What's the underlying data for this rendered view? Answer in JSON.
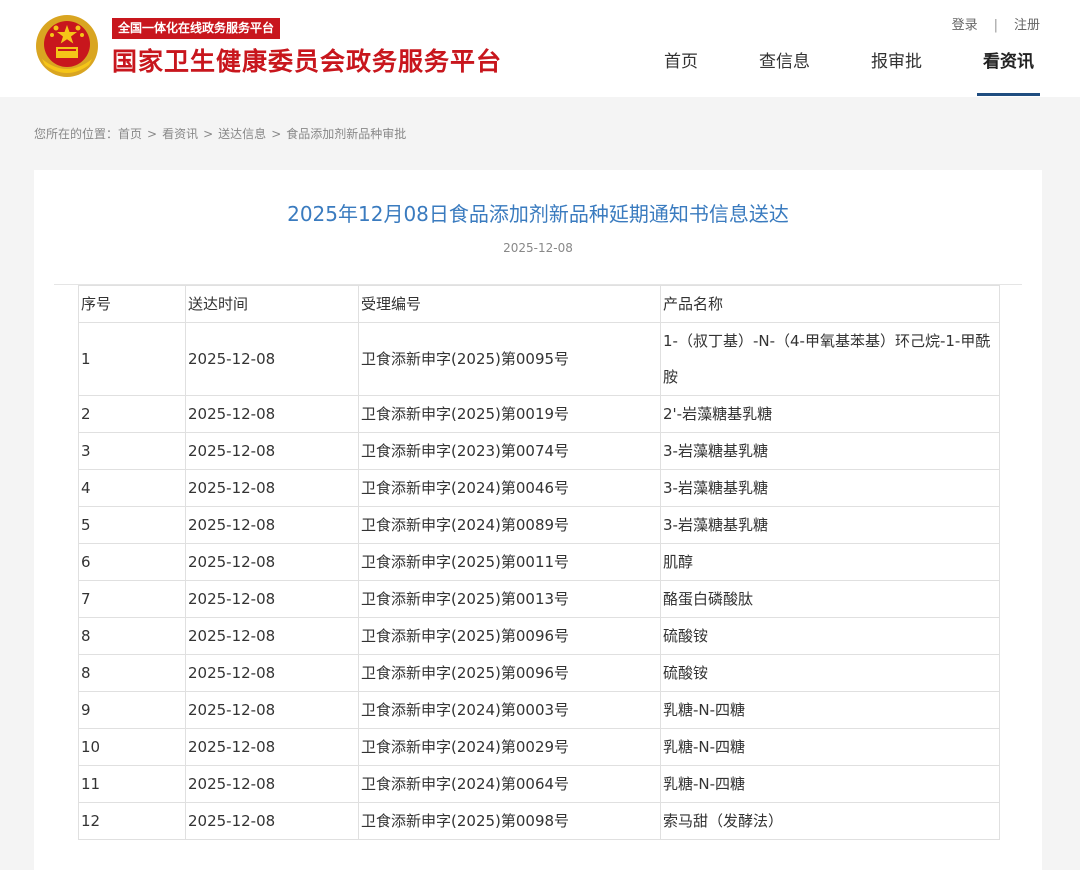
{
  "header": {
    "slogan": "全国一体化在线政务服务平台",
    "site_title": "国家卫生健康委员会政务服务平台",
    "login": "登录",
    "separator": "|",
    "register": "注册",
    "nav": [
      {
        "label": "首页"
      },
      {
        "label": "查信息"
      },
      {
        "label": "报审批"
      },
      {
        "label": "看资讯",
        "active": true
      }
    ]
  },
  "breadcrumb": {
    "prefix": "您所在的位置：",
    "items": [
      "首页",
      "看资讯",
      "送达信息",
      "食品添加剂新品种审批"
    ],
    "separator": ">"
  },
  "article": {
    "title": "2025年12月08日食品添加剂新品种延期通知书信息送达",
    "date": "2025-12-08"
  },
  "table": {
    "headers": [
      "序号",
      "送达时间",
      "受理编号",
      "产品名称"
    ],
    "rows": [
      [
        "1",
        "2025-12-08",
        "卫食添新申字(2025)第0095号",
        "1-（叔丁基）-N-（4-甲氧基苯基）环己烷-1-甲酰胺"
      ],
      [
        "2",
        "2025-12-08",
        "卫食添新申字(2025)第0019号",
        "2'-岩藻糖基乳糖"
      ],
      [
        "3",
        "2025-12-08",
        "卫食添新申字(2023)第0074号",
        "3-岩藻糖基乳糖"
      ],
      [
        "4",
        "2025-12-08",
        "卫食添新申字(2024)第0046号",
        "3-岩藻糖基乳糖"
      ],
      [
        "5",
        "2025-12-08",
        "卫食添新申字(2024)第0089号",
        "3-岩藻糖基乳糖"
      ],
      [
        "6",
        "2025-12-08",
        "卫食添新申字(2025)第0011号",
        "肌醇"
      ],
      [
        "7",
        "2025-12-08",
        "卫食添新申字(2025)第0013号",
        "酪蛋白磷酸肽"
      ],
      [
        "8",
        "2025-12-08",
        "卫食添新申字(2025)第0096号",
        "硫酸铵"
      ],
      [
        "8",
        "2025-12-08",
        "卫食添新申字(2025)第0096号",
        "硫酸铵"
      ],
      [
        "9",
        "2025-12-08",
        "卫食添新申字(2024)第0003号",
        "乳糖-N-四糖"
      ],
      [
        "10",
        "2025-12-08",
        "卫食添新申字(2024)第0029号",
        "乳糖-N-四糖"
      ],
      [
        "11",
        "2025-12-08",
        "卫食添新申字(2024)第0064号",
        "乳糖-N-四糖"
      ],
      [
        "12",
        "2025-12-08",
        "卫食添新申字(2025)第0098号",
        "索马甜（发酵法）"
      ]
    ]
  },
  "colors": {
    "brand_red": "#c8161d",
    "title_blue": "#3a7bbf",
    "nav_underline": "#1f4d80"
  },
  "icons": {
    "emblem": "national-emblem-icon"
  }
}
